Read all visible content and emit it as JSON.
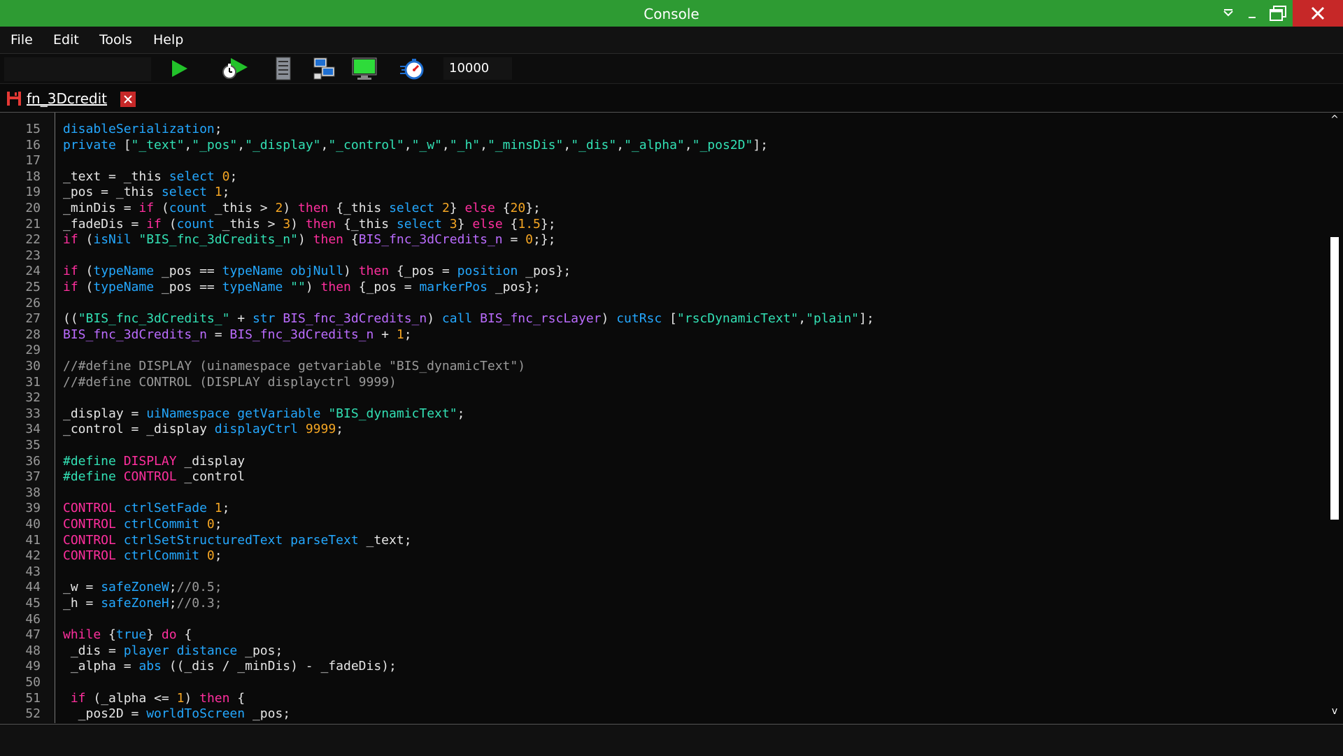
{
  "window": {
    "title": "Console"
  },
  "menu": [
    "File",
    "Edit",
    "Tools",
    "Help"
  ],
  "toolbar": {
    "search_value": "",
    "iterations": "10000"
  },
  "tab": {
    "label": "fn_3Dcredit"
  },
  "lines": [
    {
      "n": "15",
      "t": [
        [
          "b",
          "disableSerialization"
        ],
        [
          "t",
          ";"
        ]
      ]
    },
    {
      "n": "16",
      "t": [
        [
          "b",
          "private"
        ],
        [
          "t",
          " ["
        ],
        [
          "s",
          "\"_text\""
        ],
        [
          "t",
          ","
        ],
        [
          "s",
          "\"_pos\""
        ],
        [
          "t",
          ","
        ],
        [
          "s",
          "\"_display\""
        ],
        [
          "t",
          ","
        ],
        [
          "s",
          "\"_control\""
        ],
        [
          "t",
          ","
        ],
        [
          "s",
          "\"_w\""
        ],
        [
          "t",
          ","
        ],
        [
          "s",
          "\"_h\""
        ],
        [
          "t",
          ","
        ],
        [
          "s",
          "\"_minsDis\""
        ],
        [
          "t",
          ","
        ],
        [
          "s",
          "\"_dis\""
        ],
        [
          "t",
          ","
        ],
        [
          "s",
          "\"_alpha\""
        ],
        [
          "t",
          ","
        ],
        [
          "s",
          "\"_pos2D\""
        ],
        [
          "t",
          "];"
        ]
      ]
    },
    {
      "n": "17",
      "t": []
    },
    {
      "n": "18",
      "t": [
        [
          "t",
          "_text = _this "
        ],
        [
          "b",
          "select"
        ],
        [
          "t",
          " "
        ],
        [
          "n",
          "0"
        ],
        [
          "t",
          ";"
        ]
      ]
    },
    {
      "n": "19",
      "t": [
        [
          "t",
          "_pos = _this "
        ],
        [
          "b",
          "select"
        ],
        [
          "t",
          " "
        ],
        [
          "n",
          "1"
        ],
        [
          "t",
          ";"
        ]
      ]
    },
    {
      "n": "20",
      "t": [
        [
          "t",
          "_minDis = "
        ],
        [
          "k",
          "if"
        ],
        [
          "t",
          " ("
        ],
        [
          "b",
          "count"
        ],
        [
          "t",
          " _this > "
        ],
        [
          "n",
          "2"
        ],
        [
          "t",
          ") "
        ],
        [
          "k",
          "then"
        ],
        [
          "t",
          " {_this "
        ],
        [
          "b",
          "select"
        ],
        [
          "t",
          " "
        ],
        [
          "n",
          "2"
        ],
        [
          "t",
          "} "
        ],
        [
          "k",
          "else"
        ],
        [
          "t",
          " {"
        ],
        [
          "n",
          "20"
        ],
        [
          "t",
          "};"
        ]
      ]
    },
    {
      "n": "21",
      "t": [
        [
          "t",
          "_fadeDis = "
        ],
        [
          "k",
          "if"
        ],
        [
          "t",
          " ("
        ],
        [
          "b",
          "count"
        ],
        [
          "t",
          " _this > "
        ],
        [
          "n",
          "3"
        ],
        [
          "t",
          ") "
        ],
        [
          "k",
          "then"
        ],
        [
          "t",
          " {_this "
        ],
        [
          "b",
          "select"
        ],
        [
          "t",
          " "
        ],
        [
          "n",
          "3"
        ],
        [
          "t",
          "} "
        ],
        [
          "k",
          "else"
        ],
        [
          "t",
          " {"
        ],
        [
          "n",
          "1.5"
        ],
        [
          "t",
          "};"
        ]
      ]
    },
    {
      "n": "22",
      "t": [
        [
          "k",
          "if"
        ],
        [
          "t",
          " ("
        ],
        [
          "b",
          "isNil"
        ],
        [
          "t",
          " "
        ],
        [
          "s",
          "\"BIS_fnc_3dCredits_n\""
        ],
        [
          "t",
          ") "
        ],
        [
          "k",
          "then"
        ],
        [
          "t",
          " {"
        ],
        [
          "p",
          "BIS_fnc_3dCredits_n"
        ],
        [
          "t",
          " = "
        ],
        [
          "n",
          "0"
        ],
        [
          "t",
          ";};"
        ]
      ]
    },
    {
      "n": "23",
      "t": []
    },
    {
      "n": "24",
      "t": [
        [
          "k",
          "if"
        ],
        [
          "t",
          " ("
        ],
        [
          "b",
          "typeName"
        ],
        [
          "t",
          " _pos == "
        ],
        [
          "b",
          "typeName"
        ],
        [
          "t",
          " "
        ],
        [
          "b",
          "objNull"
        ],
        [
          "t",
          ") "
        ],
        [
          "k",
          "then"
        ],
        [
          "t",
          " {_pos = "
        ],
        [
          "b",
          "position"
        ],
        [
          "t",
          " _pos};"
        ]
      ]
    },
    {
      "n": "25",
      "t": [
        [
          "k",
          "if"
        ],
        [
          "t",
          " ("
        ],
        [
          "b",
          "typeName"
        ],
        [
          "t",
          " _pos == "
        ],
        [
          "b",
          "typeName"
        ],
        [
          "t",
          " "
        ],
        [
          "s",
          "\"\""
        ],
        [
          "t",
          ") "
        ],
        [
          "k",
          "then"
        ],
        [
          "t",
          " {_pos = "
        ],
        [
          "b",
          "markerPos"
        ],
        [
          "t",
          " _pos};"
        ]
      ]
    },
    {
      "n": "26",
      "t": []
    },
    {
      "n": "27",
      "t": [
        [
          "t",
          "(("
        ],
        [
          "s",
          "\"BIS_fnc_3dCredits_\""
        ],
        [
          "t",
          " + "
        ],
        [
          "b",
          "str"
        ],
        [
          "t",
          " "
        ],
        [
          "p",
          "BIS_fnc_3dCredits_n"
        ],
        [
          "t",
          ") "
        ],
        [
          "b",
          "call"
        ],
        [
          "t",
          " "
        ],
        [
          "p",
          "BIS_fnc_rscLayer"
        ],
        [
          "t",
          ") "
        ],
        [
          "b",
          "cutRsc"
        ],
        [
          "t",
          " ["
        ],
        [
          "s",
          "\"rscDynamicText\""
        ],
        [
          "t",
          ","
        ],
        [
          "s",
          "\"plain\""
        ],
        [
          "t",
          "];"
        ]
      ]
    },
    {
      "n": "28",
      "t": [
        [
          "p",
          "BIS_fnc_3dCredits_n"
        ],
        [
          "t",
          " = "
        ],
        [
          "p",
          "BIS_fnc_3dCredits_n"
        ],
        [
          "t",
          " + "
        ],
        [
          "n",
          "1"
        ],
        [
          "t",
          ";"
        ]
      ]
    },
    {
      "n": "29",
      "t": []
    },
    {
      "n": "30",
      "t": [
        [
          "c",
          "//#define DISPLAY (uinamespace getvariable \"BIS_dynamicText\")"
        ]
      ]
    },
    {
      "n": "31",
      "t": [
        [
          "c",
          "//#define CONTROL (DISPLAY displayctrl 9999)"
        ]
      ]
    },
    {
      "n": "32",
      "t": []
    },
    {
      "n": "33",
      "t": [
        [
          "t",
          "_display = "
        ],
        [
          "b",
          "uiNamespace"
        ],
        [
          "t",
          " "
        ],
        [
          "b",
          "getVariable"
        ],
        [
          "t",
          " "
        ],
        [
          "s",
          "\"BIS_dynamicText\""
        ],
        [
          "t",
          ";"
        ]
      ]
    },
    {
      "n": "34",
      "t": [
        [
          "t",
          "_control = _display "
        ],
        [
          "b",
          "displayCtrl"
        ],
        [
          "t",
          " "
        ],
        [
          "n",
          "9999"
        ],
        [
          "t",
          ";"
        ]
      ]
    },
    {
      "n": "35",
      "t": []
    },
    {
      "n": "36",
      "t": [
        [
          "s",
          "#define"
        ],
        [
          "t",
          " "
        ],
        [
          "k",
          "DISPLAY"
        ],
        [
          "t",
          " _display"
        ]
      ]
    },
    {
      "n": "37",
      "t": [
        [
          "s",
          "#define"
        ],
        [
          "t",
          " "
        ],
        [
          "k",
          "CONTROL"
        ],
        [
          "t",
          " _control"
        ]
      ]
    },
    {
      "n": "38",
      "t": []
    },
    {
      "n": "39",
      "t": [
        [
          "k",
          "CONTROL"
        ],
        [
          "t",
          " "
        ],
        [
          "b",
          "ctrlSetFade"
        ],
        [
          "t",
          " "
        ],
        [
          "n",
          "1"
        ],
        [
          "t",
          ";"
        ]
      ]
    },
    {
      "n": "40",
      "t": [
        [
          "k",
          "CONTROL"
        ],
        [
          "t",
          " "
        ],
        [
          "b",
          "ctrlCommit"
        ],
        [
          "t",
          " "
        ],
        [
          "n",
          "0"
        ],
        [
          "t",
          ";"
        ]
      ]
    },
    {
      "n": "41",
      "t": [
        [
          "k",
          "CONTROL"
        ],
        [
          "t",
          " "
        ],
        [
          "b",
          "ctrlSetStructuredText"
        ],
        [
          "t",
          " "
        ],
        [
          "b",
          "parseText"
        ],
        [
          "t",
          " _text;"
        ]
      ]
    },
    {
      "n": "42",
      "t": [
        [
          "k",
          "CONTROL"
        ],
        [
          "t",
          " "
        ],
        [
          "b",
          "ctrlCommit"
        ],
        [
          "t",
          " "
        ],
        [
          "n",
          "0"
        ],
        [
          "t",
          ";"
        ]
      ]
    },
    {
      "n": "43",
      "t": []
    },
    {
      "n": "44",
      "t": [
        [
          "t",
          "_w = "
        ],
        [
          "b",
          "safeZoneW"
        ],
        [
          "t",
          ";"
        ],
        [
          "c",
          "//0.5;"
        ]
      ]
    },
    {
      "n": "45",
      "t": [
        [
          "t",
          "_h = "
        ],
        [
          "b",
          "safeZoneH"
        ],
        [
          "t",
          ";"
        ],
        [
          "c",
          "//0.3;"
        ]
      ]
    },
    {
      "n": "46",
      "t": []
    },
    {
      "n": "47",
      "t": [
        [
          "k",
          "while"
        ],
        [
          "t",
          " {"
        ],
        [
          "b",
          "true"
        ],
        [
          "t",
          "} "
        ],
        [
          "k",
          "do"
        ],
        [
          "t",
          " {"
        ]
      ]
    },
    {
      "n": "48",
      "t": [
        [
          "t",
          " _dis = "
        ],
        [
          "b",
          "player"
        ],
        [
          "t",
          " "
        ],
        [
          "b",
          "distance"
        ],
        [
          "t",
          " _pos;"
        ]
      ]
    },
    {
      "n": "49",
      "t": [
        [
          "t",
          " _alpha = "
        ],
        [
          "b",
          "abs"
        ],
        [
          "t",
          " ((_dis / _minDis) - _fadeDis);"
        ]
      ]
    },
    {
      "n": "50",
      "t": []
    },
    {
      "n": "51",
      "t": [
        [
          "t",
          " "
        ],
        [
          "k",
          "if"
        ],
        [
          "t",
          " (_alpha <= "
        ],
        [
          "n",
          "1"
        ],
        [
          "t",
          ") "
        ],
        [
          "k",
          "then"
        ],
        [
          "t",
          " {"
        ]
      ]
    },
    {
      "n": "52",
      "t": [
        [
          "t",
          "  _pos2D = "
        ],
        [
          "b",
          "worldToScreen"
        ],
        [
          "t",
          " _pos;"
        ]
      ]
    }
  ],
  "icons": {
    "execute": "play-icon",
    "timed": "stopwatch-play-icon",
    "server": "server-icon",
    "network": "network-icon",
    "monitor": "monitor-icon",
    "performance": "performance-icon"
  },
  "colors": {
    "title_bar": "#2e9b33",
    "close": "#c62828"
  }
}
